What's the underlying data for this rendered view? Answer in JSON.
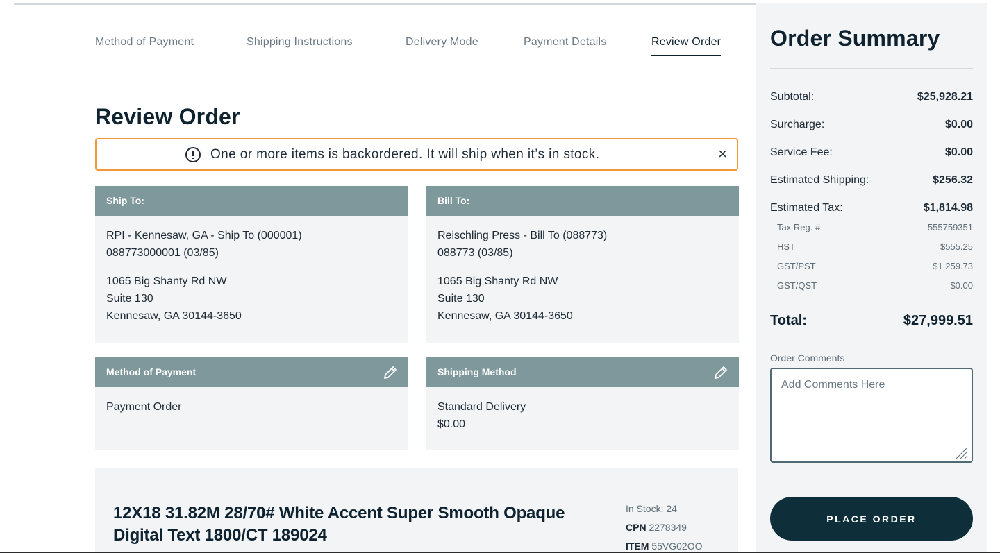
{
  "steps": [
    {
      "label": "Method of Payment"
    },
    {
      "label": "Shipping Instructions"
    },
    {
      "label": "Delivery Mode"
    },
    {
      "label": "Payment Details"
    },
    {
      "label": "Review Order",
      "active": true
    }
  ],
  "page_title": "Review Order",
  "alert": {
    "icon": "exclamation-circle-icon",
    "text": "One or more items is backordered. It will ship when it’s in stock.",
    "close": "×",
    "border_color": "#f0983a"
  },
  "ship_to": {
    "heading": "Ship To:",
    "line1": "RPI - Kennesaw, GA - Ship To (000001)",
    "line2": "088773000001 (03/85)",
    "street": "1065 Big Shanty Rd NW",
    "suite": "Suite 130",
    "city": "Kennesaw, GA 30144-3650"
  },
  "bill_to": {
    "heading": "Bill To:",
    "line1": "Reischling Press - Bill To (088773)",
    "line2": "088773 (03/85)",
    "street": "1065 Big Shanty Rd NW",
    "suite": "Suite 130",
    "city": "Kennesaw, GA 30144-3650"
  },
  "method_of_payment": {
    "heading": "Method of Payment",
    "value": "Payment Order",
    "edit_icon": "pencil-icon"
  },
  "shipping_method": {
    "heading": "Shipping Method",
    "value": "Standard Delivery",
    "price": "$0.00",
    "edit_icon": "pencil-icon"
  },
  "product": {
    "name": "12X18 31.82M 28/70# White Accent Super Smooth Opaque Digital Text 1800/CT 189024",
    "in_stock": "In Stock: 24",
    "cpn_label": "CPN",
    "cpn": "2278349",
    "item_label": "ITEM",
    "item": "55VG02OO"
  },
  "summary": {
    "title": "Order Summary",
    "subtotal": {
      "label": "Subtotal:",
      "value": "$25,928.21"
    },
    "surcharge": {
      "label": "Surcharge:",
      "value": "$0.00"
    },
    "service_fee": {
      "label": "Service Fee:",
      "value": "$0.00"
    },
    "shipping": {
      "label": "Estimated Shipping:",
      "value": "$256.32"
    },
    "tax": {
      "label": "Estimated Tax:",
      "value": "$1,814.98"
    },
    "tax_reg": {
      "label": "Tax Reg. #",
      "value": "555759351"
    },
    "hst": {
      "label": "HST",
      "value": "$555.25"
    },
    "gst_pst": {
      "label": "GST/PST",
      "value": "$1,259.73"
    },
    "gst_qst": {
      "label": "GST/QST",
      "value": "$0.00"
    },
    "total": {
      "label": "Total:",
      "value": "$27,999.51"
    },
    "comments_label": "Order Comments",
    "comments_placeholder": "Add Comments Here",
    "place_order": "PLACE ORDER"
  },
  "colors": {
    "card_header": "#7f989c",
    "card_body": "#f2f4f5",
    "primary_button": "#0e2e3a",
    "alert_border": "#f0983a"
  }
}
